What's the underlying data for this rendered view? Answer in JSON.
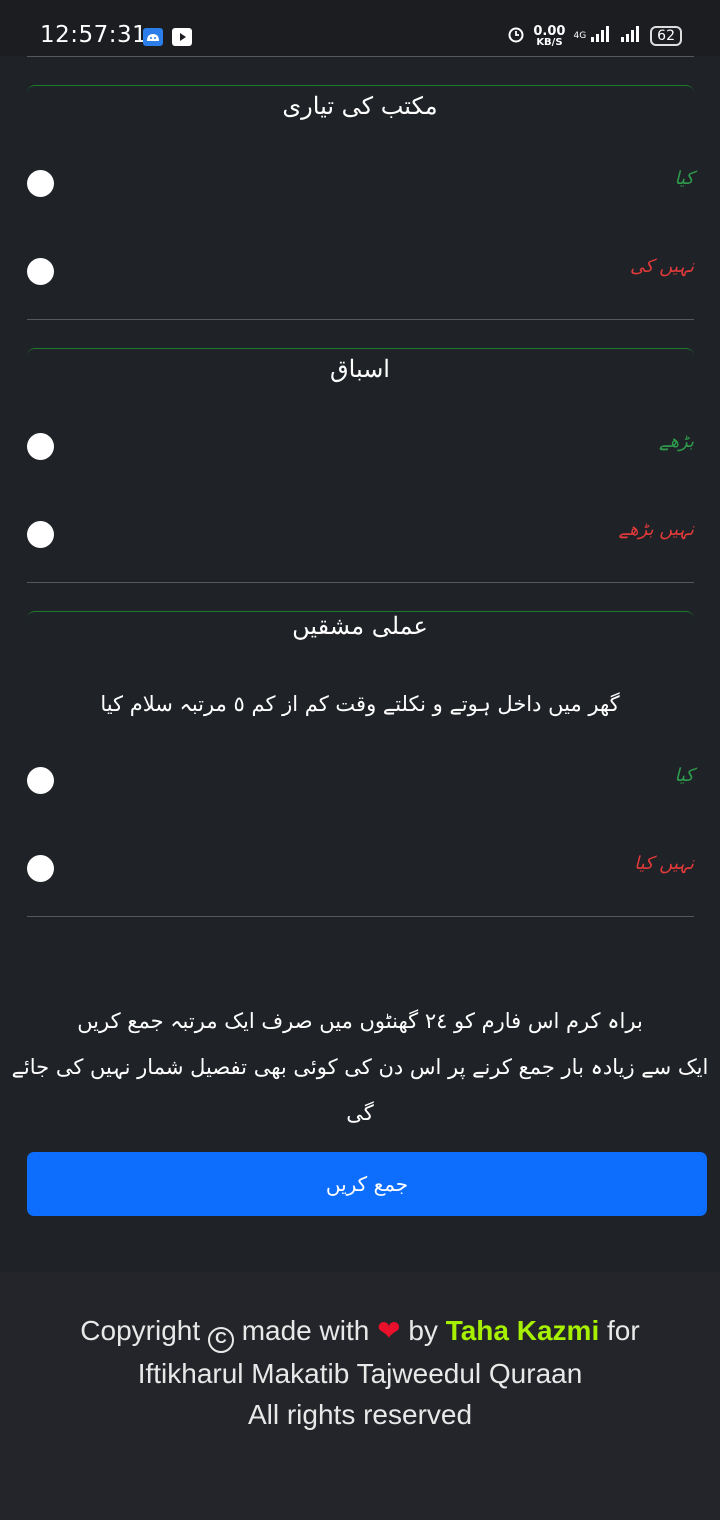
{
  "status_bar": {
    "time": "12:57:31",
    "speed_value": "0.00",
    "speed_unit": "KB/S",
    "network": "4G",
    "battery": "62"
  },
  "sections": [
    {
      "title": "مکتب کی تیاری",
      "options": [
        {
          "label": "کیا",
          "color": "#2e9b4c"
        },
        {
          "label": "نہیں کی",
          "color": "#e03a3a"
        }
      ]
    },
    {
      "title": "اسباق",
      "options": [
        {
          "label": "بڑھے",
          "color": "#2e9b4c"
        },
        {
          "label": "نہیں بڑھے",
          "color": "#e03a3a"
        }
      ]
    },
    {
      "title": "عملی مشقیں",
      "question": "گھر میں داخل ہوتے و نکلتے وقت کم از کم ٥ مرتبہ سلام کیا",
      "options": [
        {
          "label": "کیا",
          "color": "#2e9b4c"
        },
        {
          "label": "نہیں کیا",
          "color": "#e03a3a"
        }
      ]
    }
  ],
  "notice": {
    "line1": "براہ کرم اس فارم کو ٢٤ گھنٹوں میں صرف ایک مرتبہ جمع کریں",
    "line2": "ایک سے زیادہ بار جمع کرنے پر اس دن کی کوئی بھی تفصیل شمار نہیں کی جائے گی"
  },
  "submit_label": "جمع کریں",
  "footer": {
    "copyright": "Copyright",
    "copyright_symbol": "C",
    "made_with": "made with",
    "heart": "❤",
    "by": "by",
    "author": "Taha Kazmi",
    "for": "for",
    "organization": "Iftikharul Makatib Tajweedul Quraan",
    "rights": "All rights reserved"
  }
}
